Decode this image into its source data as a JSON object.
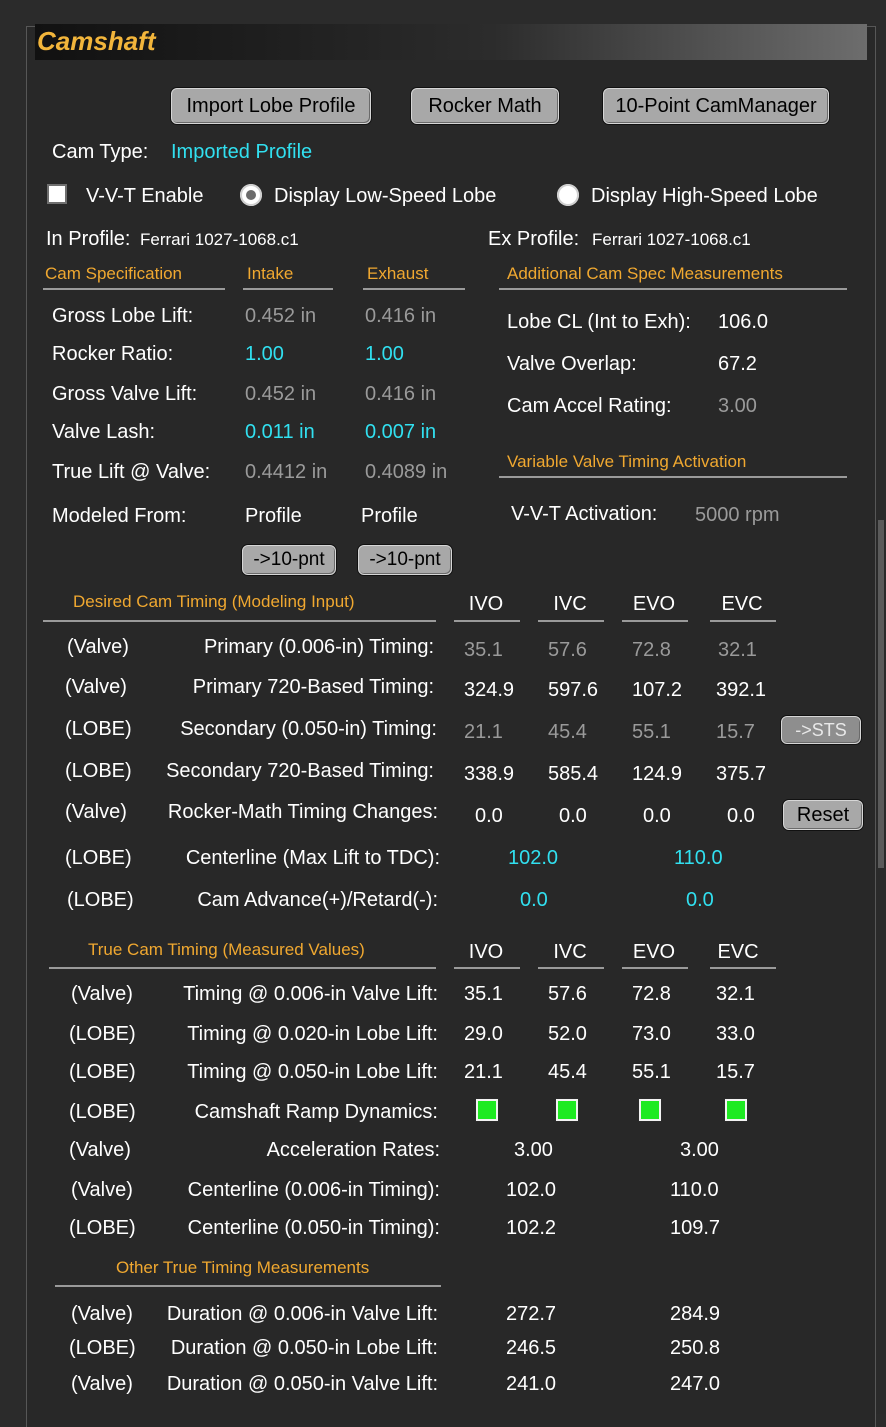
{
  "panel": {
    "title": "Camshaft"
  },
  "toolbar": {
    "import_label": "Import Lobe Profile",
    "rocker_label": "Rocker Math",
    "camman_label": "10-Point CamManager"
  },
  "cam_type": {
    "label": "Cam Type:",
    "value": "Imported Profile"
  },
  "options": {
    "vvt_enable": "V-V-T Enable",
    "low_speed": "Display Low-Speed Lobe",
    "high_speed": "Display High-Speed Lobe",
    "vvt_checked": false,
    "selected_lobe": "low"
  },
  "profiles": {
    "in_label": "In Profile:",
    "in_value": "Ferrari 1027-1068.c1",
    "ex_label": "Ex Profile:",
    "ex_value": "Ferrari 1027-1068.c1"
  },
  "spec": {
    "header": "Cam Specification",
    "intake_header": "Intake",
    "exhaust_header": "Exhaust",
    "rows": [
      {
        "label": "Gross Lobe Lift:",
        "intake": "0.452 in",
        "exhaust": "0.416 in"
      },
      {
        "label": "Rocker Ratio:",
        "intake": "1.00",
        "exhaust": "1.00"
      },
      {
        "label": "Gross Valve Lift:",
        "intake": "0.452 in",
        "exhaust": "0.416 in"
      },
      {
        "label": "Valve Lash:",
        "intake": "0.011 in",
        "exhaust": "0.007 in"
      },
      {
        "label": "True Lift @ Valve:",
        "intake": "0.4412 in",
        "exhaust": "0.4089 in"
      },
      {
        "label": "Modeled From:",
        "intake": "Profile",
        "exhaust": "Profile"
      }
    ],
    "to10_label": "->10-pnt"
  },
  "additional": {
    "header": "Additional Cam Spec Measurements",
    "rows": [
      {
        "label": "Lobe CL (Int to Exh):",
        "value": "106.0"
      },
      {
        "label": "Valve Overlap:",
        "value": "67.2"
      },
      {
        "label": "Cam Accel Rating:",
        "value": "3.00"
      }
    ]
  },
  "vvt": {
    "header": "Variable Valve Timing Activation",
    "label": "V-V-T Activation:",
    "value": "5000 rpm"
  },
  "desired": {
    "header": "Desired Cam Timing (Modeling Input)",
    "cols": [
      "IVO",
      "IVC",
      "EVO",
      "EVC"
    ],
    "rows": [
      {
        "tag": "(Valve)",
        "label": "Primary (0.006-in) Timing:",
        "v": [
          "35.1",
          "57.6",
          "72.8",
          "32.1"
        ]
      },
      {
        "tag": "(Valve)",
        "label": "Primary 720-Based Timing:",
        "v": [
          "324.9",
          "597.6",
          "107.2",
          "392.1"
        ]
      },
      {
        "tag": "(LOBE)",
        "label": "Secondary (0.050-in) Timing:",
        "v": [
          "21.1",
          "45.4",
          "55.1",
          "15.7"
        ]
      },
      {
        "tag": "(LOBE)",
        "label": "Secondary 720-Based Timing:",
        "v": [
          "338.9",
          "585.4",
          "124.9",
          "375.7"
        ]
      },
      {
        "tag": "(Valve)",
        "label": "Rocker-Math Timing Changes:",
        "v": [
          "0.0",
          "0.0",
          "0.0",
          "0.0"
        ]
      },
      {
        "tag": "(LOBE)",
        "label": "Centerline (Max Lift to TDC):",
        "v": [
          "102.0",
          "110.0"
        ]
      },
      {
        "tag": "(LOBE)",
        "label": "Cam Advance(+)/Retard(-):",
        "v": [
          "0.0",
          "0.0"
        ]
      }
    ],
    "sts_label": "->STS",
    "reset_label": "Reset"
  },
  "true_timing": {
    "header": "True Cam Timing (Measured Values)",
    "cols": [
      "IVO",
      "IVC",
      "EVO",
      "EVC"
    ],
    "rows": [
      {
        "tag": "(Valve)",
        "label": "Timing @ 0.006-in Valve Lift:",
        "v": [
          "35.1",
          "57.6",
          "72.8",
          "32.1"
        ]
      },
      {
        "tag": "(LOBE)",
        "label": "Timing @ 0.020-in Lobe Lift:",
        "v": [
          "29.0",
          "52.0",
          "73.0",
          "33.0"
        ]
      },
      {
        "tag": "(LOBE)",
        "label": "Timing @ 0.050-in Lobe Lift:",
        "v": [
          "21.1",
          "45.4",
          "55.1",
          "15.7"
        ]
      },
      {
        "tag": "(LOBE)",
        "label": "Camshaft Ramp Dynamics:",
        "indicator_color": "#1eea22"
      },
      {
        "tag": "(Valve)",
        "label": "Acceleration Rates:",
        "v": [
          "3.00",
          "3.00"
        ]
      },
      {
        "tag": "(Valve)",
        "label": "Centerline (0.006-in Timing):",
        "v": [
          "102.0",
          "110.0"
        ]
      },
      {
        "tag": "(LOBE)",
        "label": "Centerline (0.050-in Timing):",
        "v": [
          "102.2",
          "109.7"
        ]
      }
    ]
  },
  "other": {
    "header": "Other True Timing Measurements",
    "rows": [
      {
        "tag": "(Valve)",
        "label": "Duration @ 0.006-in Valve Lift:",
        "v": [
          "272.7",
          "284.9"
        ]
      },
      {
        "tag": "(LOBE)",
        "label": "Duration @ 0.050-in Lobe Lift:",
        "v": [
          "246.5",
          "250.8"
        ]
      },
      {
        "tag": "(Valve)",
        "label": "Duration @ 0.050-in Valve Lift:",
        "v": [
          "241.0",
          "247.0"
        ]
      }
    ]
  },
  "colors": {
    "accent": "#f0a830",
    "title": "#f2b53b",
    "editable": "#31e0f0",
    "readonly": "#9a9a9a",
    "ok_led": "#1eea22"
  }
}
